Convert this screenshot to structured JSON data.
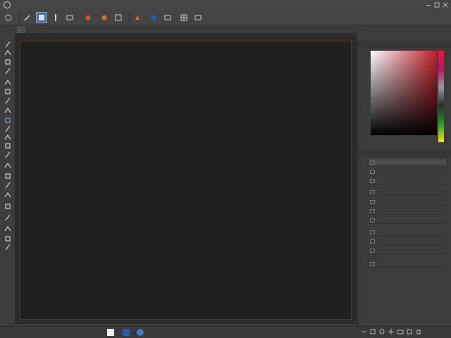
{
  "menubar": {
    "items": [
      {
        "label": ""
      },
      {
        "label": ""
      },
      {
        "label": ""
      },
      {
        "label": ""
      },
      {
        "label": ""
      },
      {
        "label": ""
      },
      {
        "label": ""
      },
      {
        "label": ""
      }
    ]
  },
  "optionsbar": {
    "labels": [
      "",
      "",
      "",
      "",
      ""
    ]
  },
  "document": {
    "tab_label": ""
  },
  "toolbar": {
    "tools": [
      "brush-tool-icon",
      "pencil-tool-icon",
      "eraser-tool-icon",
      "stamp-tool-icon",
      "dodge-tool-icon",
      "smudge-tool-icon",
      "fill-tool-icon",
      "path-tool-icon",
      "text-tool-icon",
      "transform-tool-icon",
      "move-tool-icon",
      "grid-tool-icon",
      "shape-tool-icon",
      "selection-tool-icon",
      "lasso-tool-icon",
      "crop-tool-icon",
      "rotate-tool-icon",
      "zoom-tool-icon",
      "hand-tool-icon",
      "foreground-color-icon",
      "background-color-icon",
      "swap-colors-icon"
    ]
  },
  "panels": {
    "color": {
      "title": ""
    },
    "layers": {
      "title": "",
      "blend_mode": "",
      "opacity": "",
      "rows": [
        {
          "label": ""
        },
        {
          "label": ""
        },
        {
          "label": ""
        },
        {
          "label": ""
        },
        {
          "label": ""
        },
        {
          "label": ""
        },
        {
          "label": ""
        },
        {
          "label": ""
        },
        {
          "label": ""
        },
        {
          "label": ""
        },
        {
          "label": ""
        }
      ]
    }
  },
  "statusbar": {
    "left_label": "",
    "info": ""
  },
  "colors": {
    "accent": "#5a6b85",
    "canvas": "#202020",
    "ui_bg": "#3c3c3c"
  }
}
